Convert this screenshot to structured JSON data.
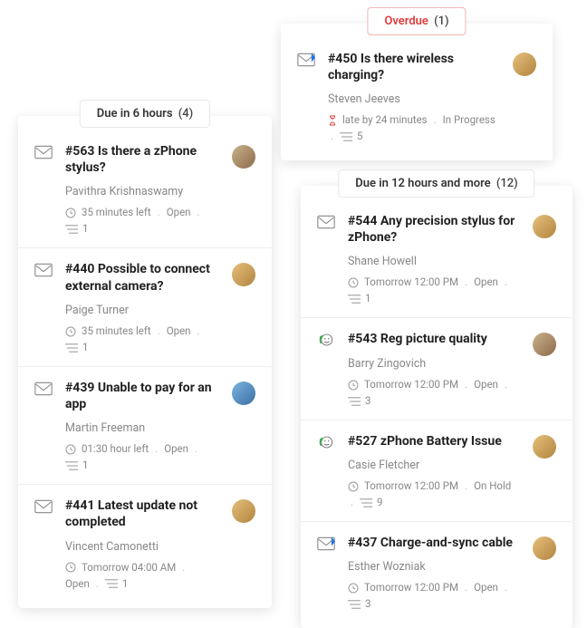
{
  "overdue": {
    "header_label": "Overdue",
    "count": "(1)",
    "tickets": [
      {
        "channel_icon": "mail-priority-icon",
        "title": "#450 Is there wireless charging?",
        "requester": "Steven Jeeves",
        "due_icon": "hourglass-icon",
        "due_text": "late by 24 minutes",
        "status": "In Progress",
        "thread_count": "5",
        "avatar_class": "av-c"
      }
    ]
  },
  "due6": {
    "header_label": "Due in 6 hours",
    "count": "(4)",
    "tickets": [
      {
        "channel_icon": "mail-icon",
        "title": "#563 Is there a zPhone stylus?",
        "requester": "Pavithra Krishnaswamy",
        "due_icon": "clock-icon",
        "due_text": "35 minutes left",
        "status": "Open",
        "thread_count": "1",
        "avatar_class": ""
      },
      {
        "channel_icon": "mail-icon",
        "title": "#440 Possible to connect external camera?",
        "requester": "Paige Turner",
        "due_icon": "clock-icon",
        "due_text": "35 minutes left",
        "status": "Open",
        "thread_count": "1",
        "avatar_class": "av-c"
      },
      {
        "channel_icon": "mail-icon",
        "title": "#439 Unable to pay for an app",
        "requester": "Martin Freeman",
        "due_icon": "clock-icon",
        "due_text": "01:30 hour left",
        "status": "Open",
        "thread_count": "1",
        "avatar_class": "av-b"
      },
      {
        "channel_icon": "mail-icon",
        "title": "#441 Latest update not completed",
        "requester": "Vincent Camonetti",
        "due_icon": "clock-icon",
        "due_text": "Tomorrow 04:00 AM",
        "status": "Open",
        "thread_count": "1",
        "avatar_class": "av-c"
      }
    ]
  },
  "due12": {
    "header_label": "Due in 12 hours and more",
    "count": "(12)",
    "tickets": [
      {
        "channel_icon": "mail-icon",
        "title": "#544 Any precision stylus for zPhone?",
        "requester": "Shane Howell",
        "due_icon": "clock-icon",
        "due_text": "Tomorrow 12:00 PM",
        "status": "Open",
        "thread_count": "1",
        "avatar_class": "av-c"
      },
      {
        "channel_icon": "feedback-icon",
        "title": "#543 Reg picture quality",
        "requester": "Barry Zingovich",
        "due_icon": "clock-icon",
        "due_text": "Tomorrow 12:00 PM",
        "status": "Open",
        "thread_count": "3",
        "avatar_class": ""
      },
      {
        "channel_icon": "feedback-icon",
        "title": "#527 zPhone Battery Issue",
        "requester": "Casie Fletcher",
        "due_icon": "clock-icon",
        "due_text": "Tomorrow 12:00 PM",
        "status": "On Hold",
        "thread_count": "9",
        "avatar_class": "av-c"
      },
      {
        "channel_icon": "mail-priority-icon",
        "title": "#437 Charge-and-sync cable",
        "requester": "Esther Wozniak",
        "due_icon": "clock-icon",
        "due_text": "Tomorrow 12:00 PM",
        "status": "Open",
        "thread_count": "3",
        "avatar_class": "av-c"
      }
    ]
  }
}
